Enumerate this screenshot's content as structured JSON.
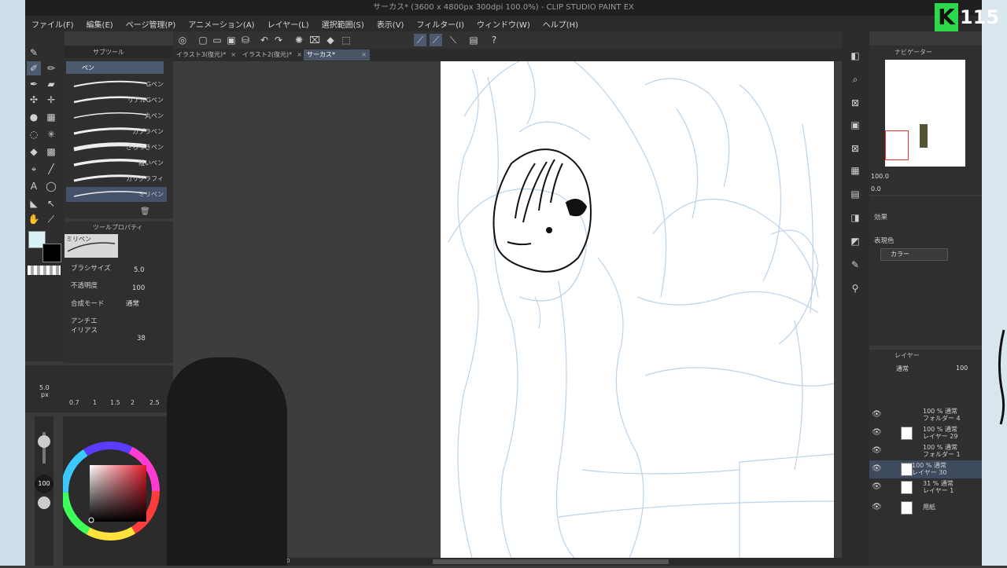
{
  "window": {
    "title": "サーカス* (3600 x 4800px 300dpi 100.0%)  - CLIP STUDIO PAINT EX"
  },
  "menu": [
    "ファイル(F)",
    "編集(E)",
    "ページ管理(P)",
    "アニメーション(A)",
    "レイヤー(L)",
    "選択範囲(S)",
    "表示(V)",
    "フィルター(I)",
    "ウィンドウ(W)",
    "ヘルプ(H)"
  ],
  "tabs": [
    {
      "label": "イラスト3(復元)*"
    },
    {
      "label": "イラスト2(復元)*"
    },
    {
      "label": "サーカス*",
      "active": true
    }
  ],
  "subtool": {
    "header": "サブツール",
    "group": "ペン",
    "brushes": [
      "Gペン",
      "リアルGペン",
      "丸ペン",
      "カブラペン",
      "ざらつきペン",
      "粗いペン",
      "カリグラフィ",
      "ミリペン"
    ],
    "selected": "ミリペン"
  },
  "tool_property": {
    "header": "ツールプロパティ",
    "preset": "ミリペン",
    "rows": [
      {
        "label": "ブラシサイズ",
        "value": "5.0"
      },
      {
        "label": "不透明度",
        "value": "100"
      },
      {
        "label": "合成モード",
        "value": "通常"
      },
      {
        "label": "アンチエイリアス",
        "value": ""
      }
    ],
    "extra_value": "38"
  },
  "brush_size": {
    "current": "5.0",
    "unit": "px",
    "presets": [
      "0.7",
      "1",
      "1.5",
      "2",
      "2.5"
    ]
  },
  "color": {
    "main": "#d8f2f8",
    "sub": "#000000",
    "opacity_label": "100 %"
  },
  "navigator": {
    "header": "ナビゲーター",
    "zoom": "100.0",
    "rotation": "0.0"
  },
  "effect": {
    "header": "効果",
    "display_color_label": "表現色",
    "display_color_value": "カラー"
  },
  "layers": {
    "header": "レイヤー",
    "blend": "通常",
    "opacity": "100",
    "items": [
      {
        "line1": "100 % 通常",
        "line2": "フォルダー 4",
        "kind": "folder"
      },
      {
        "line1": "100 % 通常",
        "line2": "レイヤー 29",
        "kind": "layer"
      },
      {
        "line1": "100 % 通常",
        "line2": "フォルダー 1",
        "kind": "folder"
      },
      {
        "line1": "100 % 通常",
        "line2": "レイヤー 30",
        "kind": "layer",
        "selected": true
      },
      {
        "line1": "31 % 通常",
        "line2": "レイヤー 1",
        "kind": "layer"
      },
      {
        "line1": "",
        "line2": "用紙",
        "kind": "paper"
      }
    ]
  },
  "status": {
    "zoom": "0"
  },
  "overlay": {
    "channel_badge": "115"
  }
}
